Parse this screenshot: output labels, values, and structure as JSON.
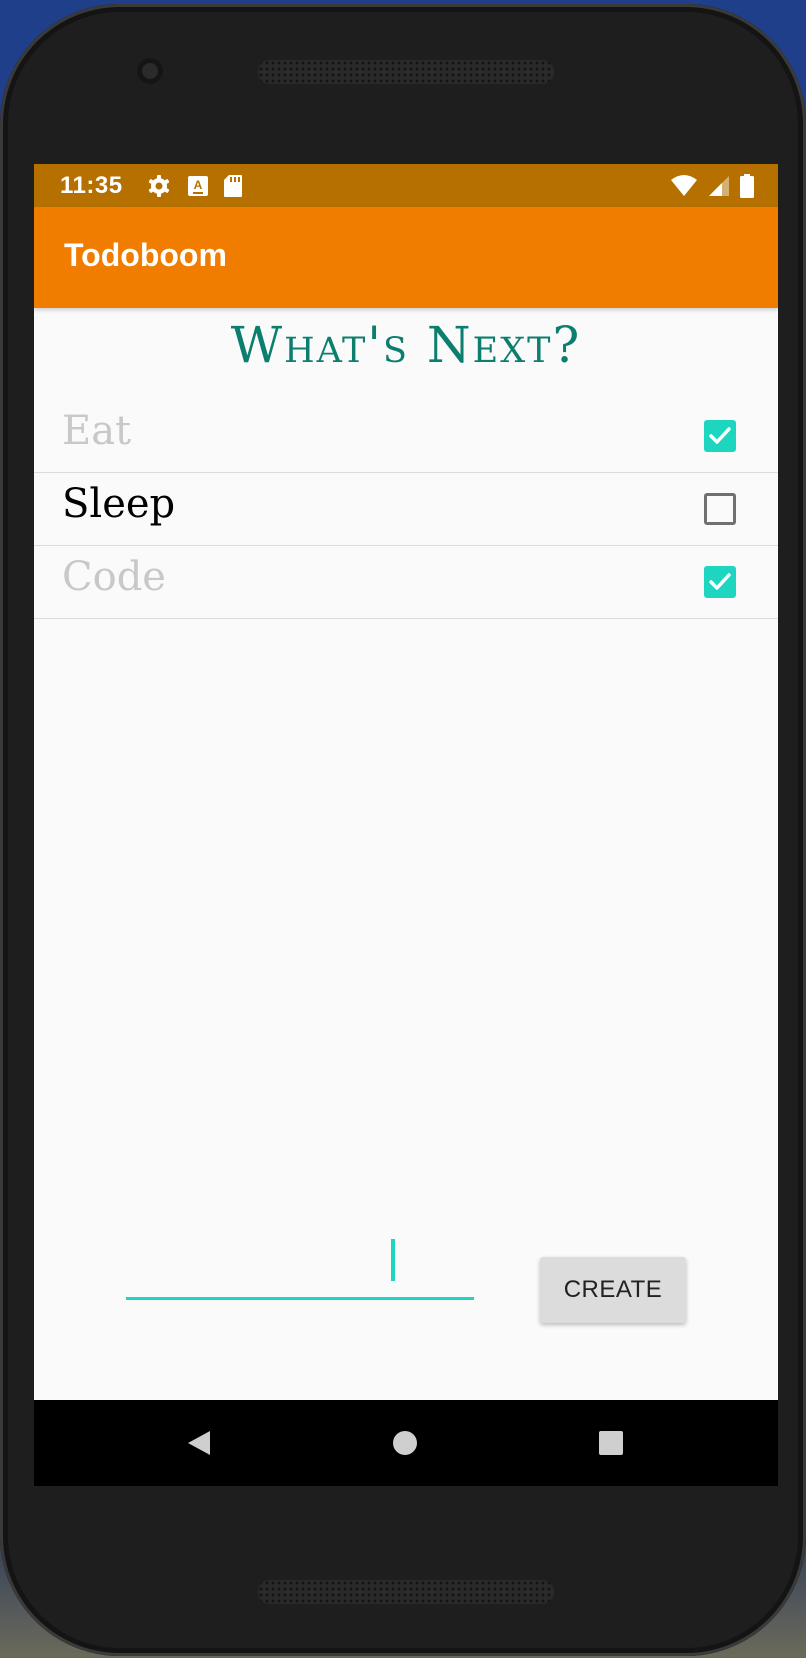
{
  "status_bar": {
    "time": "11:35",
    "icons": [
      "settings-icon",
      "keyboard-icon",
      "sd-card-icon",
      "wifi-icon",
      "signal-icon",
      "battery-icon"
    ]
  },
  "app_bar": {
    "title": "Todoboom"
  },
  "heading": "What's Next?",
  "todos": [
    {
      "text": "Eat",
      "done": true
    },
    {
      "text": "Sleep",
      "done": false
    },
    {
      "text": "Code",
      "done": true
    }
  ],
  "new_todo": {
    "value": "",
    "placeholder": ""
  },
  "create_label": "CREATE",
  "colors": {
    "status_bar": "#b57000",
    "app_bar": "#f07c00",
    "heading": "#0b7e6e",
    "accent": "#1ed6c0",
    "done_text": "#c8c8c8"
  },
  "nav": [
    "back-icon",
    "home-icon",
    "recents-icon"
  ]
}
